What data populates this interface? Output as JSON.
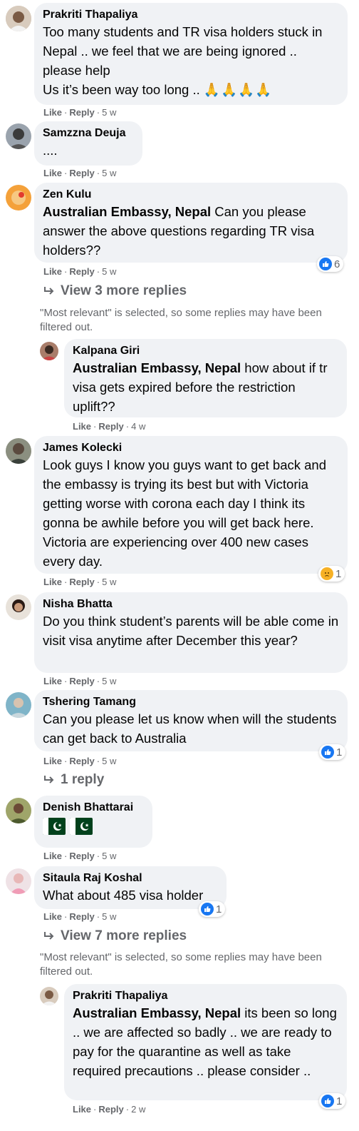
{
  "comments": [
    {
      "author": "Prakriti Thapaliya",
      "text": "Too many students and TR visa holders stuck in Nepal .. we feel that we are being ignored .. please help\nUs it’s been way too long ..",
      "emoji": "🙏🙏🙏🙏",
      "like": "Like",
      "reply": "Reply",
      "time": "5 w"
    },
    {
      "author": "Samzzna Deuja",
      "text": "....",
      "like": "Like",
      "reply": "Reply",
      "time": "5 w"
    },
    {
      "author": "Zen Kulu",
      "mention": "Australian Embassy, Nepal",
      "text": " Can you please answer the above questions regarding TR visa holders??",
      "like": "Like",
      "reply": "Reply",
      "time": "5 w",
      "reaction_count": "6",
      "view_replies": "View 3 more replies",
      "note": "\"Most relevant\" is selected, so some replies may have been filtered out."
    },
    {
      "author": "Kalpana Giri",
      "mention": "Australian Embassy, Nepal",
      "text": " how about if tr visa gets expired before the restriction uplift??",
      "like": "Like",
      "reply": "Reply",
      "time": "4 w"
    },
    {
      "author": "James Kolecki",
      "text": "Look guys I know you guys want to get back and the embassy is trying its best but with Victoria getting worse with corona each day I think its gonna be awhile before you will get back here. Victoria are experiencing over 400 new cases every day.",
      "like": "Like",
      "reply": "Reply",
      "time": "5 w",
      "reaction_count": "1"
    },
    {
      "author": "Nisha Bhatta",
      "text": "Do you think student’s parents will be able come in visit visa anytime after December this year?",
      "like": "Like",
      "reply": "Reply",
      "time": "5 w"
    },
    {
      "author": "Tshering Tamang",
      "text": "Can you please let us know when will the students can get back to Australia",
      "like": "Like",
      "reply": "Reply",
      "time": "5 w",
      "reaction_count": "1",
      "view_replies": "1 reply"
    },
    {
      "author": "Denish Bhattarai",
      "like": "Like",
      "reply": "Reply",
      "time": "5 w"
    },
    {
      "author": "Sitaula Raj Koshal",
      "text": "What about 485 visa holder",
      "like": "Like",
      "reply": "Reply",
      "time": "5 w",
      "reaction_count": "1",
      "view_replies": "View 7 more replies",
      "note": "\"Most relevant\" is selected, so some replies may have been filtered out."
    },
    {
      "author": "Prakriti Thapaliya",
      "mention": "Australian Embassy, Nepal",
      "text": " its been so long .. we are affected so badly .. we are ready to pay for the quarantine as well as take required precautions .. please consider ..",
      "like": "Like",
      "reply": "Reply",
      "time": "2 w",
      "reaction_count": "1"
    }
  ],
  "colors": {
    "bubble": "#f0f2f5",
    "meta": "#65676b",
    "like_blue": "#1877f2",
    "sad_yellow": "#f7b125"
  }
}
